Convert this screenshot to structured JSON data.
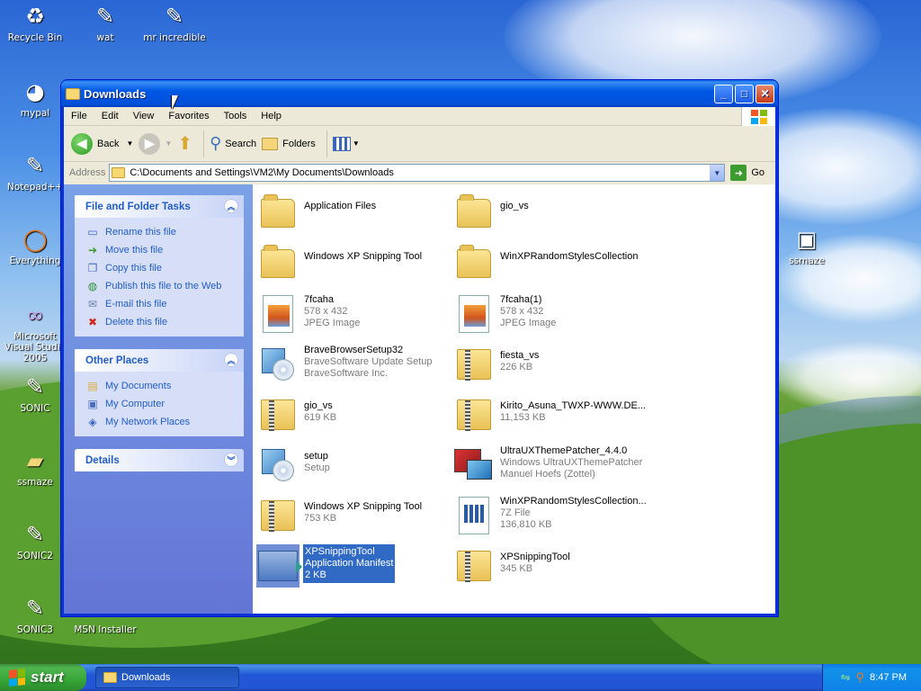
{
  "desktop": {
    "icons": [
      {
        "label": "Recycle Bin",
        "icon": "recycle-bin-icon",
        "glyph": "♻"
      },
      {
        "label": "wat",
        "icon": "paintbrush-icon",
        "glyph": "✎"
      },
      {
        "label": "mr incredible",
        "icon": "paintbrush-icon",
        "glyph": "✎"
      },
      {
        "label": "mypal",
        "icon": "raccoon-icon",
        "glyph": "◕"
      },
      {
        "label": "Notepad++",
        "icon": "notepad-icon",
        "glyph": "✎"
      },
      {
        "label": "Everything",
        "icon": "search-ring-icon",
        "glyph": "◯"
      },
      {
        "label": "Microsoft Visual Studio 2005",
        "icon": "visual-studio-icon",
        "glyph": "∞"
      },
      {
        "label": "SONIC",
        "icon": "paintbrush-icon",
        "glyph": "✎"
      },
      {
        "label": "ssmaze",
        "icon": "folder-icon",
        "glyph": "▰"
      },
      {
        "label": "SONIC2",
        "icon": "paintbrush-icon",
        "glyph": "✎"
      },
      {
        "label": "SONIC3",
        "icon": "paintbrush-icon",
        "glyph": "✎"
      },
      {
        "label": "MSN Installer",
        "icon": "installer-icon",
        "glyph": ""
      },
      {
        "label": "ssmaze",
        "icon": "computer-icon",
        "glyph": "▣"
      }
    ]
  },
  "window": {
    "title": "Downloads",
    "controls": {
      "minimize": "_",
      "maximize": "□",
      "close": "✕"
    },
    "menu": [
      "File",
      "Edit",
      "View",
      "Favorites",
      "Tools",
      "Help"
    ],
    "toolbar": {
      "back": "Back",
      "search": "Search",
      "folders": "Folders"
    },
    "address": {
      "label": "Address",
      "value": "C:\\Documents and Settings\\VM2\\My Documents\\Downloads",
      "go": "Go"
    }
  },
  "taskpane": {
    "file_tasks": {
      "title": "File and Folder Tasks",
      "items": [
        {
          "label": "Rename this file",
          "icon": "rename-icon",
          "glyph": "▭"
        },
        {
          "label": "Move this file",
          "icon": "move-icon",
          "glyph": "➜"
        },
        {
          "label": "Copy this file",
          "icon": "copy-icon",
          "glyph": "❐"
        },
        {
          "label": "Publish this file to the Web",
          "icon": "globe-icon",
          "glyph": "◍"
        },
        {
          "label": "E-mail this file",
          "icon": "email-icon",
          "glyph": "✉"
        },
        {
          "label": "Delete this file",
          "icon": "delete-icon",
          "glyph": "✖"
        }
      ]
    },
    "other_places": {
      "title": "Other Places",
      "items": [
        {
          "label": "My Documents",
          "icon": "my-documents-icon",
          "glyph": "▤"
        },
        {
          "label": "My Computer",
          "icon": "my-computer-icon",
          "glyph": "▣"
        },
        {
          "label": "My Network Places",
          "icon": "network-icon",
          "glyph": "◈"
        }
      ]
    },
    "details": {
      "title": "Details"
    }
  },
  "files": [
    {
      "name": "Application Files",
      "line2": "",
      "line3": "",
      "type": "folder"
    },
    {
      "name": "gio_vs",
      "line2": "",
      "line3": "",
      "type": "folder"
    },
    {
      "name": "Windows XP Snipping Tool",
      "line2": "",
      "line3": "",
      "type": "folder"
    },
    {
      "name": "WinXPRandomStylesCollection",
      "line2": "",
      "line3": "",
      "type": "folder"
    },
    {
      "name": "7fcaha",
      "line2": "578 x 432",
      "line3": "JPEG Image",
      "type": "jpg"
    },
    {
      "name": "7fcaha(1)",
      "line2": "578 x 432",
      "line3": "JPEG Image",
      "type": "jpg"
    },
    {
      "name": "BraveBrowserSetup32",
      "line2": "BraveSoftware Update Setup",
      "line3": "BraveSoftware Inc.",
      "type": "setup"
    },
    {
      "name": "fiesta_vs",
      "line2": "226 KB",
      "line3": "",
      "type": "zip"
    },
    {
      "name": "gio_vs",
      "line2": "619 KB",
      "line3": "",
      "type": "zip"
    },
    {
      "name": "Kirito_Asuna_TWXP-WWW.DE...",
      "line2": "11,153 KB",
      "line3": "",
      "type": "zip"
    },
    {
      "name": "setup",
      "line2": "Setup",
      "line3": "",
      "type": "setup"
    },
    {
      "name": "UltraUXThemePatcher_4.4.0",
      "line2": "Windows UltraUXThemePatcher",
      "line3": "Manuel Hoefs (Zottel)",
      "type": "patcher"
    },
    {
      "name": "Windows XP Snipping Tool",
      "line2": "753 KB",
      "line3": "",
      "type": "zip"
    },
    {
      "name": "WinXPRandomStylesCollection...",
      "line2": "7Z File",
      "line3": "136,810 KB",
      "type": "sevenz"
    },
    {
      "name": "XPSnippingTool",
      "line2": "Application Manifest",
      "line3": "2 KB",
      "type": "manifest",
      "selected": true
    },
    {
      "name": "XPSnippingTool",
      "line2": "345 KB",
      "line3": "",
      "type": "zip"
    }
  ],
  "taskbar": {
    "start": "start",
    "task": "Downloads",
    "clock": "8:47 PM"
  },
  "colors": {
    "link": "#215dc6",
    "selection": "#316ac5"
  }
}
